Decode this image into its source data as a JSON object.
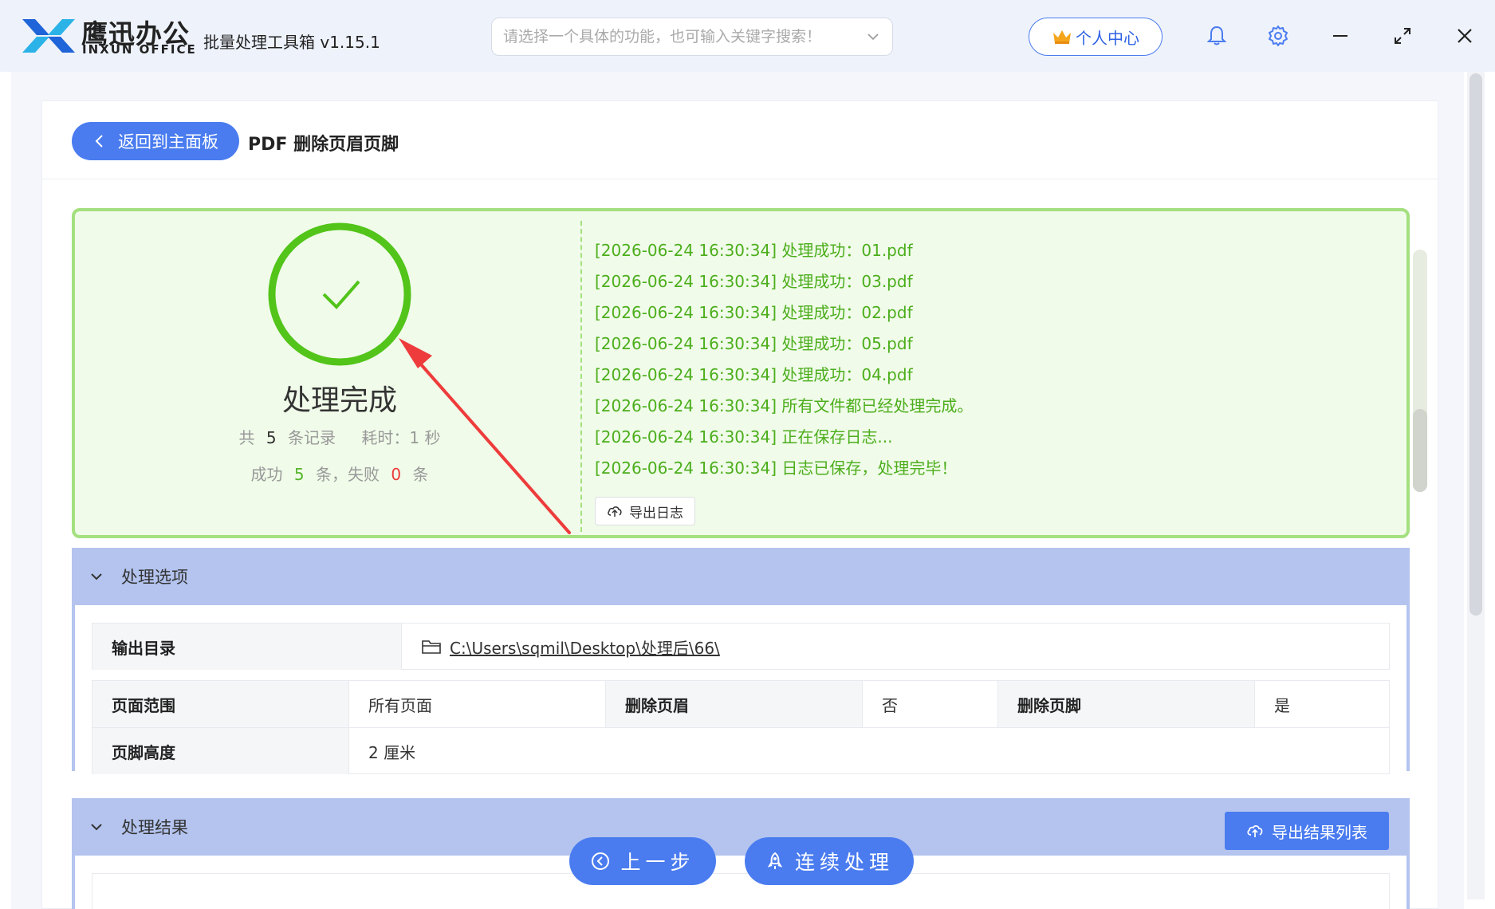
{
  "titlebar": {
    "brand_cn": "鹰迅办公",
    "brand_en": "INXUN OFFICE",
    "app_title": "批量处理工具箱 v1.15.1",
    "search_placeholder": "请选择一个具体的功能，也可输入关键字搜索！",
    "personal_center": "个人中心"
  },
  "header": {
    "back_label": "返回到主面板",
    "page_title": "PDF 删除页眉页脚"
  },
  "result": {
    "title": "处理完成",
    "total_prefix": "共",
    "total_count": "5",
    "total_suffix": "条记录",
    "time_label": "耗时：1 秒",
    "success_prefix": "成功",
    "success_count": "5",
    "success_suffix": "条，失败",
    "fail_count": "0",
    "fail_suffix": "条",
    "logs": [
      "[2026-06-24 16:30:34] 处理成功：01.pdf",
      "[2026-06-24 16:30:34] 处理成功：03.pdf",
      "[2026-06-24 16:30:34] 处理成功：02.pdf",
      "[2026-06-24 16:30:34] 处理成功：05.pdf",
      "[2026-06-24 16:30:34] 处理成功：04.pdf",
      "[2026-06-24 16:30:34] 所有文件都已经处理完成。",
      "[2026-06-24 16:30:34] 正在保存日志...",
      "[2026-06-24 16:30:34] 日志已保存，处理完毕！"
    ],
    "export_log": "导出日志"
  },
  "options": {
    "header": "处理选项",
    "output_dir_label": "输出目录",
    "output_dir_value": "C:\\Users\\sqmil\\Desktop\\处理后\\66\\",
    "page_range_label": "页面范围",
    "page_range_value": "所有页面",
    "del_header_label": "删除页眉",
    "del_header_value": "否",
    "del_footer_label": "删除页脚",
    "del_footer_value": "是",
    "footer_height_label": "页脚高度",
    "footer_height_value": "2 厘米"
  },
  "results_section": {
    "header": "处理结果",
    "export_list": "导出结果列表"
  },
  "actions": {
    "prev_step": "上一步",
    "continue": "连续处理"
  },
  "colors": {
    "accent": "#4a7cf0",
    "success": "#4cae1c",
    "fail": "#ec3a3a",
    "section": "#b4c4ef",
    "annotation_arrow": "#ee3b3b"
  }
}
